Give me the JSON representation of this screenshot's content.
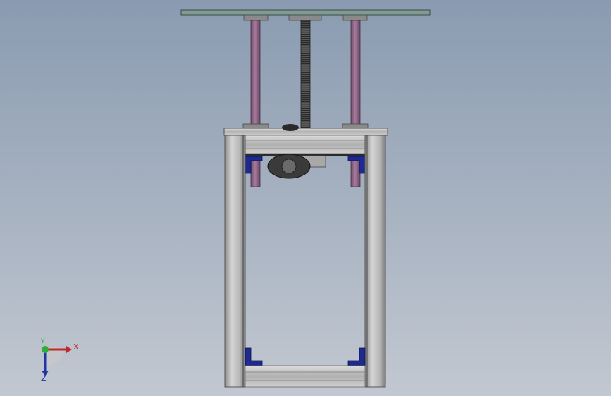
{
  "viewport": {
    "background_top": "#8a9bb1",
    "background_bottom": "#c2c8d1"
  },
  "model": {
    "plate_color": "#7e9c92",
    "guide_rod_color": "#9b6d92",
    "frame_color": "#b8b8b8",
    "bracket_color": "#1e2a8e",
    "lead_screw_color": "#4a4a4a",
    "motor_color": "#2b2b2b"
  },
  "triad": {
    "x_label": "X",
    "y_label": "Y",
    "z_label": "Z",
    "x_color": "#c0292b",
    "y_color": "#2fae3a",
    "z_color": "#2034a8"
  }
}
